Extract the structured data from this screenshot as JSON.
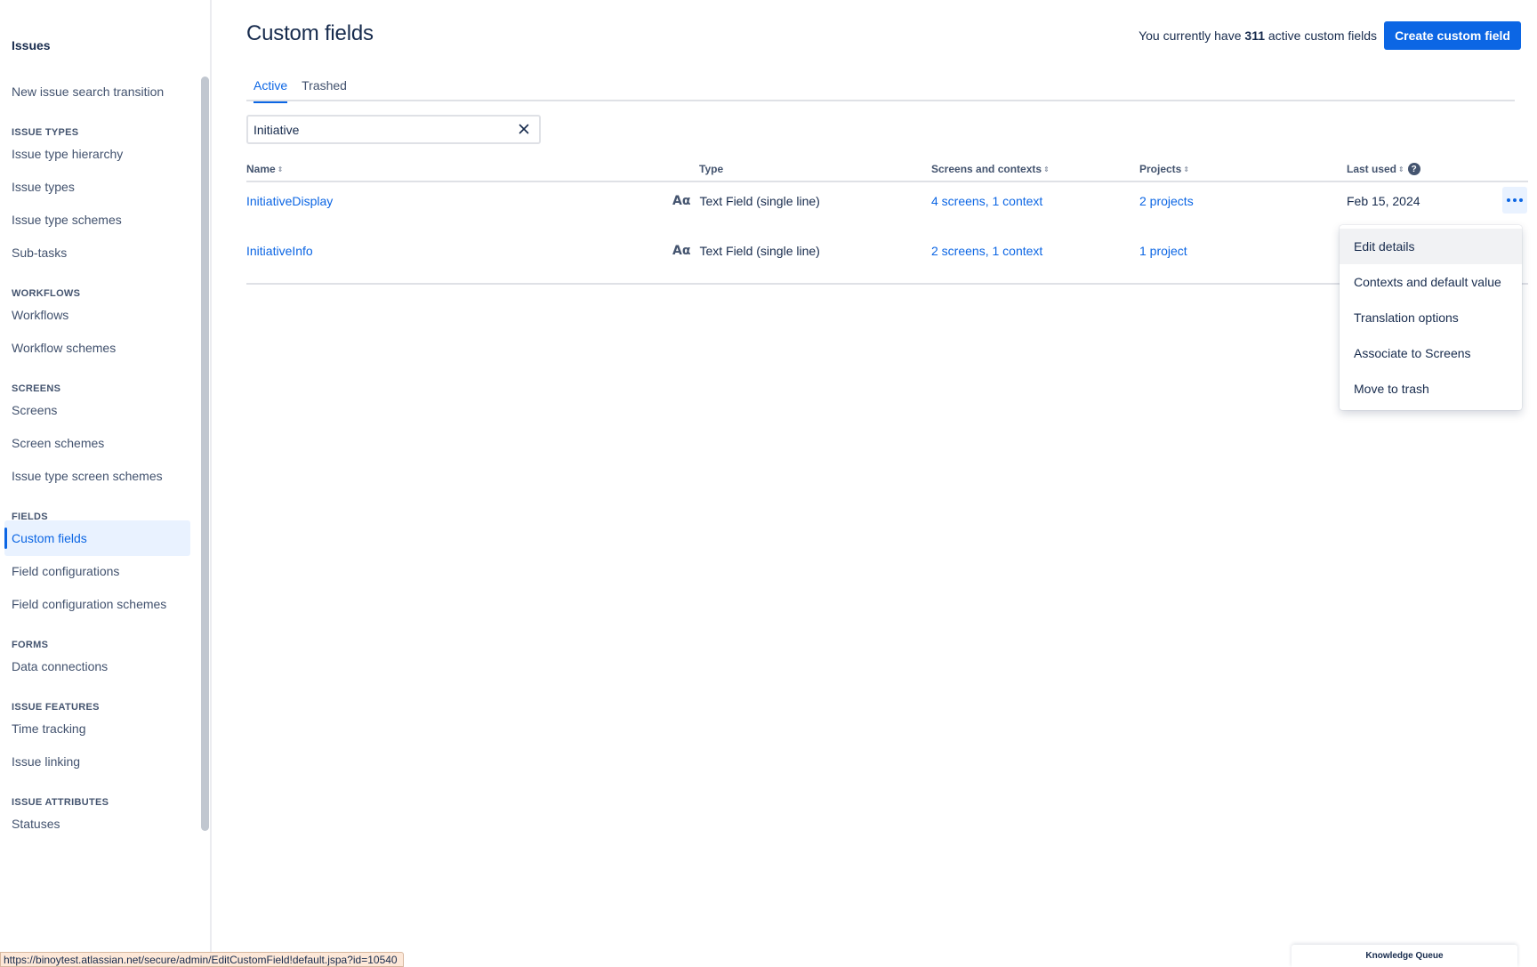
{
  "sidebar": {
    "title": "Issues",
    "items": [
      {
        "label": "New issue search transition"
      },
      {
        "section": "ISSUE TYPES"
      },
      {
        "label": "Issue type hierarchy"
      },
      {
        "label": "Issue types"
      },
      {
        "label": "Issue type schemes"
      },
      {
        "label": "Sub-tasks"
      },
      {
        "section": "WORKFLOWS"
      },
      {
        "label": "Workflows"
      },
      {
        "label": "Workflow schemes"
      },
      {
        "section": "SCREENS"
      },
      {
        "label": "Screens"
      },
      {
        "label": "Screen schemes"
      },
      {
        "label": "Issue type screen schemes"
      },
      {
        "section": "FIELDS"
      },
      {
        "label": "Custom fields",
        "active": true
      },
      {
        "label": "Field configurations"
      },
      {
        "label": "Field configuration schemes"
      },
      {
        "section": "FORMS"
      },
      {
        "label": "Data connections"
      },
      {
        "section": "ISSUE FEATURES"
      },
      {
        "label": "Time tracking"
      },
      {
        "label": "Issue linking"
      },
      {
        "section": "ISSUE ATTRIBUTES"
      },
      {
        "label": "Statuses"
      }
    ]
  },
  "header": {
    "title": "Custom fields",
    "count_prefix": "You currently have",
    "count": "311",
    "count_suffix": "active custom fields",
    "create_button": "Create custom field"
  },
  "tabs": [
    {
      "label": "Active",
      "active": true
    },
    {
      "label": "Trashed",
      "active": false
    }
  ],
  "search": {
    "value": "Initiative"
  },
  "table": {
    "columns": [
      "Name",
      "Type",
      "Screens and contexts",
      "Projects",
      "Last used"
    ],
    "rows": [
      {
        "name": "InitiativeDisplay",
        "type": "Text Field (single line)",
        "screens": "4 screens, 1 context",
        "projects": "2 projects",
        "last_used": "Feb 15, 2024"
      },
      {
        "name": "InitiativeInfo",
        "type": "Text Field (single line)",
        "screens": "2 screens, 1 context",
        "projects": "1 project",
        "last_used": ""
      }
    ],
    "type_icon_glyph": "Aα"
  },
  "row_menu": {
    "items": [
      "Edit details",
      "Contexts and default value",
      "Translation options",
      "Associate to Screens",
      "Move to trash"
    ]
  },
  "status_bar_url": "https://binoytest.atlassian.net/secure/admin/EditCustomField!default.jspa?id=10540",
  "footer_tab": "Knowledge Queue",
  "colors": {
    "accent": "#0c66e4",
    "active_bg": "#e9f2ff"
  }
}
